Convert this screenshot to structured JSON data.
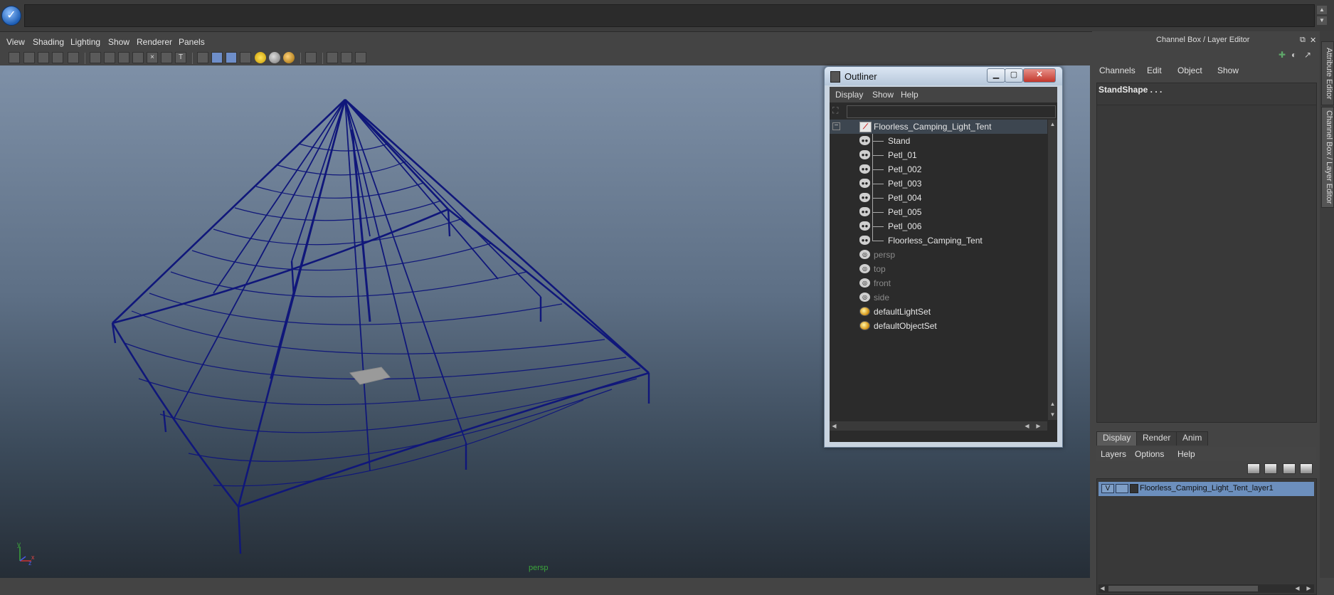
{
  "shelf": {
    "check_icon": "check-circle-icon"
  },
  "viewport": {
    "menus": [
      "View",
      "Shading",
      "Lighting",
      "Show",
      "Renderer",
      "Panels"
    ],
    "camera_label": "persp",
    "axis": {
      "y": "y",
      "x": "x",
      "z": "z"
    },
    "wire_color": "#10177a"
  },
  "outliner": {
    "title": "Outliner",
    "menus": [
      "Display",
      "Show",
      "Help"
    ],
    "nodes": [
      {
        "label": "Floorless_Camping_Light_Tent",
        "type": "group",
        "level": 0,
        "selected": true,
        "dim": false
      },
      {
        "label": "Stand",
        "type": "xform",
        "level": 1,
        "dim": false
      },
      {
        "label": "Petl_01",
        "type": "xform",
        "level": 1,
        "dim": false
      },
      {
        "label": "Petl_002",
        "type": "xform",
        "level": 1,
        "dim": false
      },
      {
        "label": "Petl_003",
        "type": "xform",
        "level": 1,
        "dim": false
      },
      {
        "label": "Petl_004",
        "type": "xform",
        "level": 1,
        "dim": false
      },
      {
        "label": "Petl_005",
        "type": "xform",
        "level": 1,
        "dim": false
      },
      {
        "label": "Petl_006",
        "type": "xform",
        "level": 1,
        "dim": false
      },
      {
        "label": "Floorless_Camping_Tent",
        "type": "xform",
        "level": 1,
        "dim": false
      },
      {
        "label": "persp",
        "type": "cam",
        "level": 0,
        "dim": true
      },
      {
        "label": "top",
        "type": "cam",
        "level": 0,
        "dim": true
      },
      {
        "label": "front",
        "type": "cam",
        "level": 0,
        "dim": true
      },
      {
        "label": "side",
        "type": "cam",
        "level": 0,
        "dim": true
      },
      {
        "label": "defaultLightSet",
        "type": "set",
        "level": 0,
        "dim": false
      },
      {
        "label": "defaultObjectSet",
        "type": "set",
        "level": 0,
        "dim": false
      }
    ],
    "buttons": {
      "minimize": "▁",
      "maximize": "▢",
      "close": "✕"
    }
  },
  "channel_box": {
    "title": "Channel Box / Layer Editor",
    "menus": [
      "Channels",
      "Edit",
      "Object",
      "Show"
    ],
    "object_name": "StandShape . . ."
  },
  "layer_editor": {
    "tabs": [
      "Display",
      "Render",
      "Anim"
    ],
    "active_tab": "Display",
    "menus": [
      "Layers",
      "Options",
      "Help"
    ],
    "layers": [
      {
        "visible": "V",
        "name": "Floorless_Camping_Light_Tent_layer1"
      }
    ]
  },
  "side_tabs": [
    "Attribute Editor",
    "Channel Box / Layer Editor"
  ],
  "colors": {
    "accent": "#6c8fbd",
    "viewport_top": "#7e90a7",
    "viewport_bottom": "#252d36"
  }
}
